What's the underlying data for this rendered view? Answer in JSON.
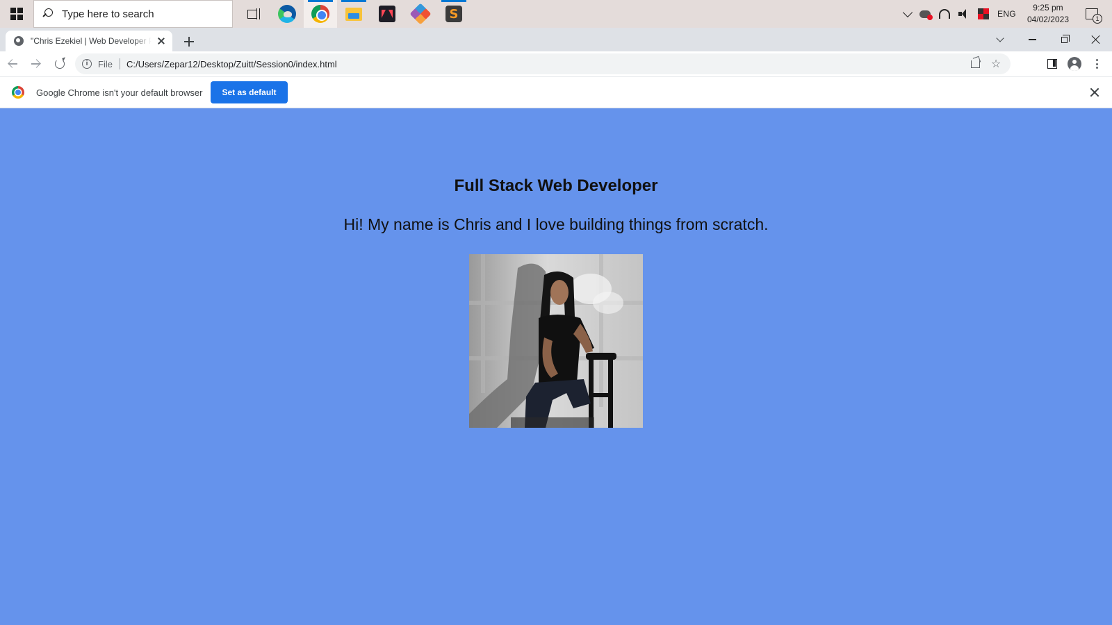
{
  "taskbar": {
    "search_placeholder": "Type here to search",
    "apps": [
      "task-view",
      "microsoft-edge",
      "google-chrome",
      "file-explorer",
      "valorant",
      "git",
      "sublime-text"
    ],
    "tray": {
      "language": "ENG",
      "time": "9:25 pm",
      "date": "04/02/2023",
      "notification_count": "1"
    }
  },
  "browser": {
    "tab": {
      "title": "\"Chris Ezekiel | Web Developer Portfolio\""
    },
    "address": {
      "scheme_label": "File",
      "url": "C:/Users/Zepar12/Desktop/Zuitt/Session0/index.html"
    },
    "infobar": {
      "message": "Google Chrome isn't your default browser",
      "button_label": "Set as default"
    }
  },
  "page": {
    "heading": "Full Stack Web Developer",
    "intro": "Hi! My name is Chris and I love building things from scratch.",
    "background_color": "#6593ec"
  },
  "colors": {
    "accent": "#1a73e8",
    "running_indicator": "#0078d4"
  }
}
